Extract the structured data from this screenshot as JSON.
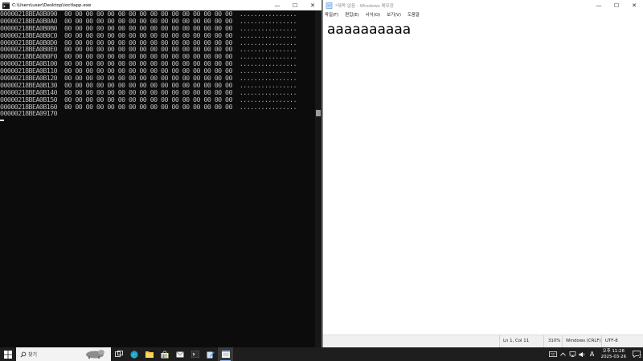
{
  "console": {
    "title": "C:\\Users\\user\\Desktop\\ioctlapp.exe",
    "lines": [
      "00000218BEA0B090  00 00 00 00 00 00 00 00 00 00 00 00 00 00 00 00  ................",
      "00000218BEA0B0A0  00 00 00 00 00 00 00 00 00 00 00 00 00 00 00 00  ................",
      "00000218BEA0B0B0  00 00 00 00 00 00 00 00 00 00 00 00 00 00 00 00  ................",
      "00000218BEA0B0C0  00 00 00 00 00 00 00 00 00 00 00 00 00 00 00 00  ................",
      "00000218BEA0B0D0  00 00 00 00 00 00 00 00 00 00 00 00 00 00 00 00  ................",
      "00000218BEA0B0E0  00 00 00 00 00 00 00 00 00 00 00 00 00 00 00 00  ................",
      "00000218BEA0B0F0  00 00 00 00 00 00 00 00 00 00 00 00 00 00 00 00  ................",
      "00000218BEA0B100  00 00 00 00 00 00 00 00 00 00 00 00 00 00 00 00  ................",
      "00000218BEA0B110  00 00 00 00 00 00 00 00 00 00 00 00 00 00 00 00  ................",
      "00000218BEA0B120  00 00 00 00 00 00 00 00 00 00 00 00 00 00 00 00  ................",
      "00000218BEA0B130  00 00 00 00 00 00 00 00 00 00 00 00 00 00 00 00  ................",
      "00000218BEA0B140  00 00 00 00 00 00 00 00 00 00 00 00 00 00 00 00  ................",
      "00000218BEA0B150  00 00 00 00 00 00 00 00 00 00 00 00 00 00 00 00  ................",
      "00000218BEA0B160  00 00 00 00 00 00 00 00 00 00 00 00 00 00 00 00  ................",
      "00000218BEA09170"
    ]
  },
  "notepad": {
    "title": "*제목 없음 - Windows 메모장",
    "menu": [
      "파일(F)",
      "편집(E)",
      "서식(O)",
      "보기(V)",
      "도움말"
    ],
    "content": "aaaaaaaaaa",
    "status": {
      "position": "Ln 1, Col 11",
      "zoom": "310%",
      "line_ending": "Windows (CRLF)",
      "encoding": "UTF-8"
    }
  },
  "taskbar": {
    "search_label": "찾기",
    "tray_ime": "A",
    "clock_time": "오후 11:28",
    "clock_date": "2025-03-26",
    "notification_count": "2"
  },
  "colors": {
    "console_bg": "#0c0c0c",
    "console_text": "#bdbdbd",
    "taskbar_bg": "#1e1e1e",
    "accent": "#0078d7"
  }
}
